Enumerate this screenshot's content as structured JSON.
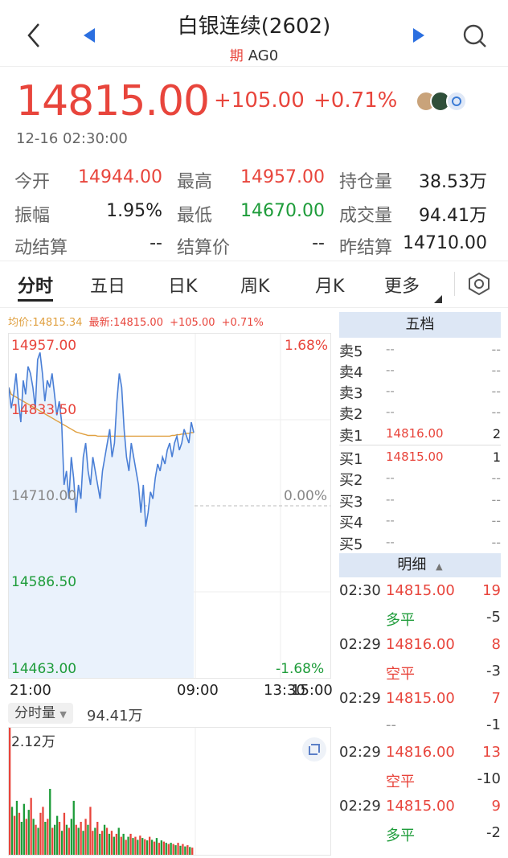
{
  "nav": {
    "title": "白银连续(2602)",
    "badge": "期",
    "symbol": "AG0"
  },
  "quote": {
    "last": "14815.00",
    "change": "+105.00",
    "change_pct": "+0.71%",
    "time": "12-16 02:30:00"
  },
  "stats": [
    {
      "label": "今开",
      "value": "14944.00",
      "color": "red"
    },
    {
      "label": "最高",
      "value": "14957.00",
      "color": "red"
    },
    {
      "label": "持仓量",
      "value": "38.53万",
      "color": "black"
    },
    {
      "label": "振幅",
      "value": "1.95%",
      "color": "black"
    },
    {
      "label": "最低",
      "value": "14670.00",
      "color": "green"
    },
    {
      "label": "成交量",
      "value": "94.41万",
      "color": "black"
    },
    {
      "label": "动结算",
      "value": "--",
      "color": "black"
    },
    {
      "label": "结算价",
      "value": "--",
      "color": "black"
    },
    {
      "label": "昨结算",
      "value": "14710.00",
      "color": "black"
    }
  ],
  "tabs": [
    "分时",
    "五日",
    "日K",
    "周K",
    "月K",
    "更多"
  ],
  "chart_header": {
    "avg": "均价:14815.34",
    "latest": "最新:14815.00",
    "chg": "+105.00",
    "pct": "+0.71%"
  },
  "chart_labels": {
    "y_top": "14957.00",
    "y_mid_hi": "14833.50",
    "y_mid": "14710.00",
    "y_mid_lo": "14586.50",
    "y_bottom": "14463.00",
    "pct_top": "1.68%",
    "pct_mid": "0.00%",
    "pct_bottom": "-1.68%",
    "x_ticks": [
      "21:00",
      "09:00",
      "13:30",
      "15:00"
    ]
  },
  "volume": {
    "selector": "分时量",
    "total": "94.41万",
    "max_label": "2.12万"
  },
  "order_book": {
    "title": "五档",
    "rows": [
      {
        "side": "卖5",
        "price": "--",
        "qty": "--"
      },
      {
        "side": "卖4",
        "price": "--",
        "qty": "--"
      },
      {
        "side": "卖3",
        "price": "--",
        "qty": "--"
      },
      {
        "side": "卖2",
        "price": "--",
        "qty": "--"
      },
      {
        "side": "卖1",
        "price": "14816.00",
        "qty": "2"
      },
      {
        "side": "买1",
        "price": "14815.00",
        "qty": "1"
      },
      {
        "side": "买2",
        "price": "--",
        "qty": "--"
      },
      {
        "side": "买3",
        "price": "--",
        "qty": "--"
      },
      {
        "side": "买4",
        "price": "--",
        "qty": "--"
      },
      {
        "side": "买5",
        "price": "--",
        "qty": "--"
      }
    ]
  },
  "ticks": {
    "title": "明细",
    "rows": [
      {
        "time": "02:30",
        "price": "14815.00",
        "vol": "19",
        "type": "多平",
        "oi": "-5"
      },
      {
        "time": "02:29",
        "price": "14816.00",
        "vol": "8",
        "type": "空平",
        "oi": "-3"
      },
      {
        "time": "02:29",
        "price": "14815.00",
        "vol": "7",
        "type": "--",
        "oi": "-1"
      },
      {
        "time": "02:29",
        "price": "14816.00",
        "vol": "13",
        "type": "空平",
        "oi": "-10"
      },
      {
        "time": "02:29",
        "price": "14815.00",
        "vol": "9",
        "type": "多平",
        "oi": "-2"
      }
    ]
  },
  "chart_data": {
    "type": "line",
    "ylim": [
      14463.0,
      14957.0
    ],
    "y_ref": 14710.0,
    "price": [
      14880,
      14850,
      14870,
      14900,
      14860,
      14830,
      14890,
      14870,
      14910,
      14900,
      14880,
      14850,
      14920,
      14930,
      14900,
      14860,
      14890,
      14880,
      14900,
      14870,
      14840,
      14860,
      14830,
      14740,
      14760,
      14720,
      14780,
      14750,
      14700,
      14740,
      14720,
      14780,
      14800,
      14760,
      14740,
      14780,
      14760,
      14740,
      14720,
      14760,
      14780,
      14800,
      14820,
      14780,
      14800,
      14860,
      14900,
      14880,
      14820,
      14780,
      14760,
      14800,
      14780,
      14760,
      14740,
      14700,
      14740,
      14680,
      14700,
      14730,
      14720,
      14750,
      14770,
      14760,
      14780,
      14770,
      14790,
      14800,
      14780,
      14800,
      14810,
      14790,
      14800,
      14820,
      14810,
      14800,
      14830,
      14815
    ],
    "avg": [
      14880,
      14870,
      14868,
      14866,
      14864,
      14862,
      14860,
      14858,
      14856,
      14854,
      14852,
      14850,
      14848,
      14846,
      14844,
      14842,
      14840,
      14838,
      14836,
      14834,
      14832,
      14830,
      14828,
      14826,
      14824,
      14822,
      14820,
      14818,
      14816,
      14815,
      14814,
      14813,
      14812,
      14811,
      14811,
      14811,
      14811,
      14810,
      14810,
      14810,
      14810,
      14810,
      14810,
      14810,
      14810,
      14810,
      14810,
      14810,
      14810,
      14810,
      14810,
      14810,
      14810,
      14810,
      14810,
      14810,
      14810,
      14810,
      14810,
      14810,
      14810,
      14810,
      14810,
      14810,
      14810,
      14810,
      14810,
      14810,
      14811,
      14811,
      14812,
      14812,
      14813,
      14813,
      14814,
      14814,
      14815,
      14815
    ],
    "volume_max": 21200,
    "volumes": [
      21200,
      8000,
      6500,
      9000,
      7000,
      5500,
      8500,
      6000,
      7500,
      9500,
      6000,
      5000,
      4500,
      7000,
      8000,
      5500,
      6000,
      11000,
      4500,
      5000,
      6500,
      5500,
      4000,
      7000,
      5000,
      4500,
      6000,
      9000,
      5000,
      4500,
      5500,
      4000,
      6000,
      5000,
      8000,
      4000,
      4500,
      5500,
      3500,
      4000,
      5000,
      4500,
      3500,
      4000,
      3000,
      3500,
      4500,
      3000,
      3500,
      2500,
      3000,
      3500,
      2800,
      3000,
      2500,
      3200,
      2800,
      2600,
      2400,
      3000,
      2500,
      2200,
      2800,
      2000,
      2400,
      2200,
      2000,
      1800,
      2000,
      1800,
      1600,
      2000,
      1500,
      1800,
      1400,
      1600,
      1300,
      1200
    ],
    "volume_colors": [
      "red",
      "green",
      "red",
      "green",
      "red",
      "green",
      "green",
      "red",
      "green",
      "red",
      "green",
      "red",
      "green",
      "red",
      "red",
      "green",
      "red",
      "green",
      "red",
      "green",
      "green",
      "red",
      "green",
      "red",
      "green",
      "red",
      "green",
      "green",
      "red",
      "green",
      "red",
      "green",
      "red",
      "green",
      "red",
      "red",
      "green",
      "red",
      "green",
      "red",
      "green",
      "red",
      "green",
      "red",
      "green",
      "red",
      "green",
      "red",
      "green",
      "red",
      "green",
      "red",
      "green",
      "red",
      "green",
      "red",
      "green",
      "red",
      "green",
      "red",
      "green",
      "red",
      "green",
      "red",
      "green",
      "red",
      "green",
      "red",
      "green",
      "red",
      "green",
      "red",
      "green",
      "red",
      "green",
      "red",
      "green",
      "red"
    ]
  },
  "colors": {
    "red": "#e8453c",
    "green": "#1e9c3a",
    "line": "#4a7fd6",
    "avg": "#e0a040",
    "fill": "#eaf2fc"
  }
}
